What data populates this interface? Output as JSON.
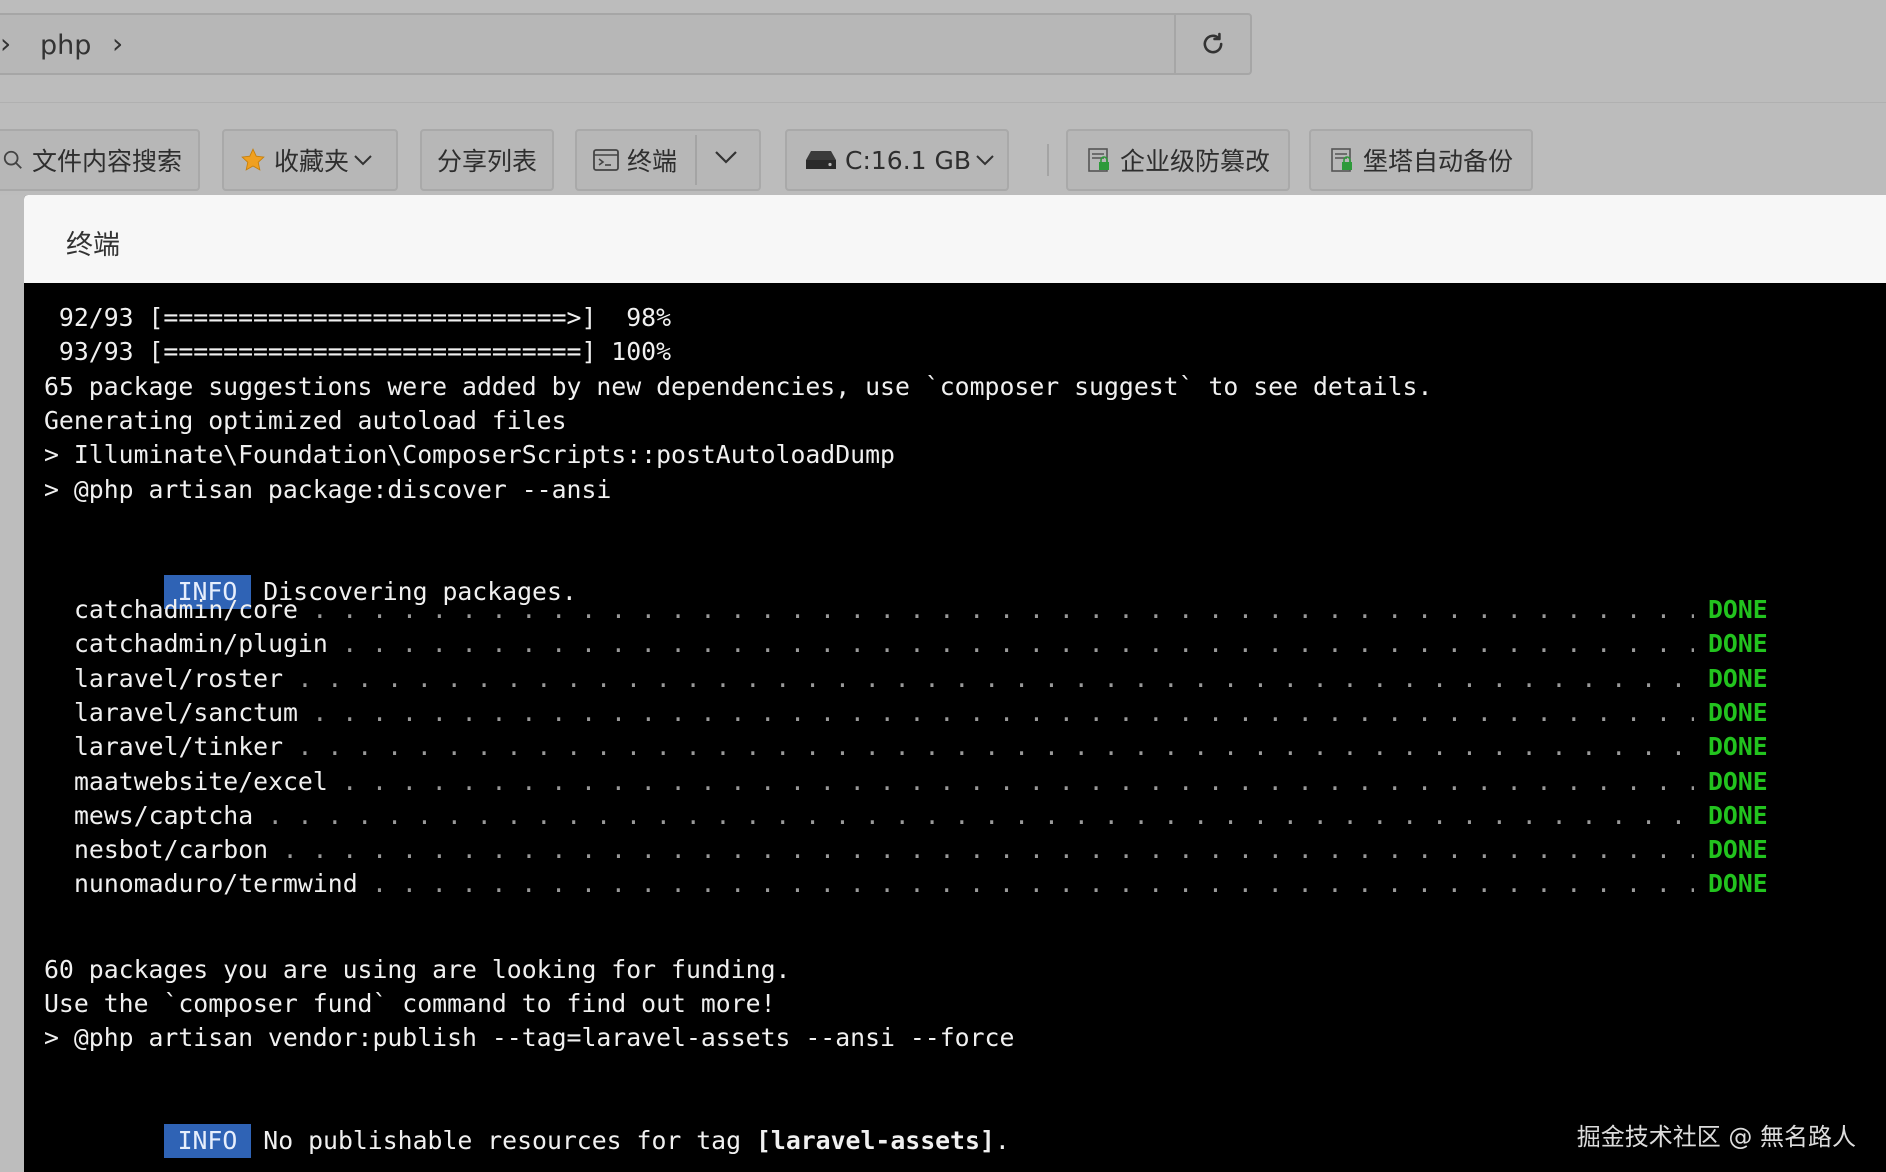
{
  "addressbar": {
    "path": "php"
  },
  "toolbar": {
    "search_label": "文件内容搜索",
    "favorites_label": "收藏夹",
    "share_label": "分享列表",
    "terminal_label": "终端",
    "disk_label": "C:16.1 GB",
    "tamper_label": "企业级防篡改",
    "backup_label": "堡塔自动备份"
  },
  "modal": {
    "title": "终端"
  },
  "terminal": {
    "progress1": " 92/93 [===========================>]  98%",
    "progress2": " 93/93 [============================] 100%",
    "suggestions": "65 package suggestions were added by new dependencies, use `composer suggest` to see details.",
    "autoload": "Generating optimized autoload files",
    "cmd1": "> Illuminate\\Foundation\\ComposerScripts::postAutoloadDump",
    "cmd2": "> @php artisan package:discover --ansi",
    "info_tag": "INFO",
    "discovering": "Discovering packages.",
    "done_label": "DONE",
    "packages": [
      "catchadmin/core",
      "catchadmin/plugin",
      "laravel/roster",
      "laravel/sanctum",
      "laravel/tinker",
      "maatwebsite/excel",
      "mews/captcha",
      "nesbot/carbon",
      "nunomaduro/termwind"
    ],
    "funding": "60 packages you are using are looking for funding.",
    "fund_cmd": "Use the `composer fund` command to find out more!",
    "cmd3": "> @php artisan vendor:publish --tag=laravel-assets --ansi --force",
    "no_publish_prefix": "No publishable resources for tag ",
    "no_publish_tag": "[laravel-assets]",
    "no_publish_suffix": "."
  },
  "watermark": "掘金技术社区 @ 無名路人",
  "colors": {
    "done": "#22c31e",
    "info_bg": "#2f63b5",
    "terminal_bg": "#000000"
  }
}
